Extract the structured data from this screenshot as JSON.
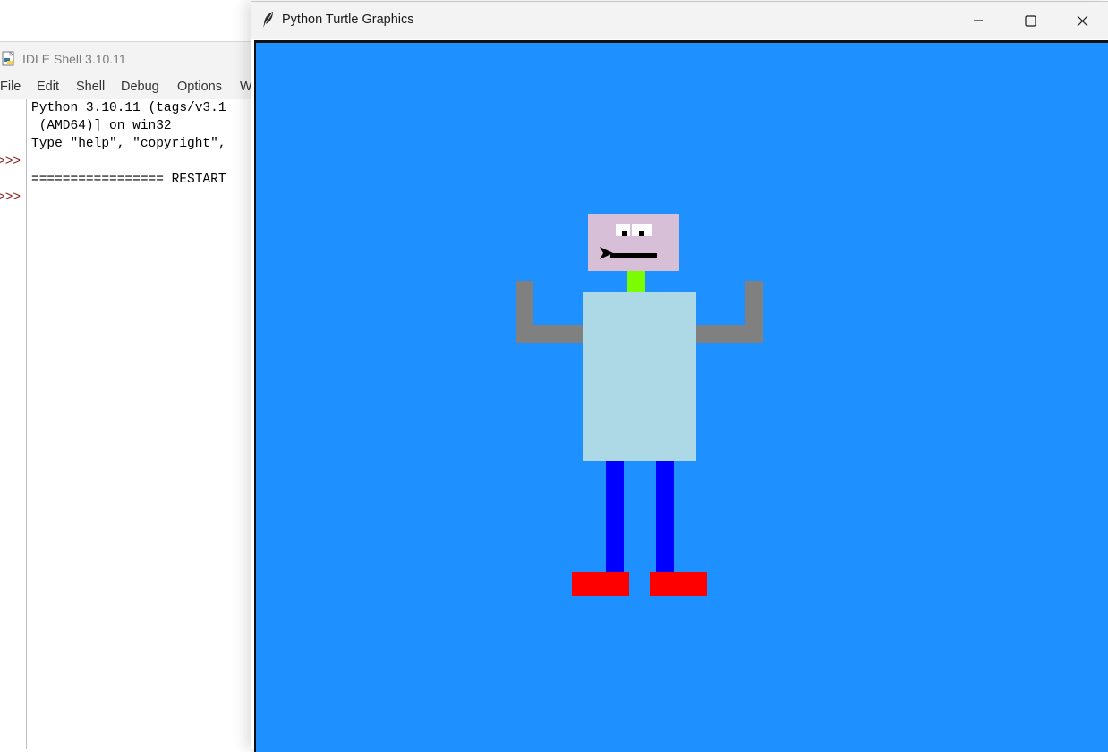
{
  "idle": {
    "title": "IDLE Shell 3.10.11",
    "menu": [
      "File",
      "Edit",
      "Shell",
      "Debug",
      "Options",
      "W"
    ],
    "lines": [
      "Python 3.10.11 (tags/v3.1",
      " (AMD64)] on win32",
      "Type \"help\", \"copyright\",",
      "================= RESTART"
    ],
    "prompt": ">>>"
  },
  "turtle": {
    "title": "Python Turtle Graphics",
    "minimize_icon": "minimize-icon",
    "maximize_icon": "maximize-icon",
    "close_icon": "close-icon",
    "canvas_color": "#1e90ff",
    "colors": {
      "head": "#d8bfd8",
      "eyes": "#ffffff",
      "pupils": "#000000",
      "mouth": "#000000",
      "neck": "#7cfc00",
      "body": "#add8e6",
      "arms": "#808080",
      "legs": "#0000ff",
      "feet": "#ff0000",
      "turtle_cursor": "#000000"
    }
  }
}
